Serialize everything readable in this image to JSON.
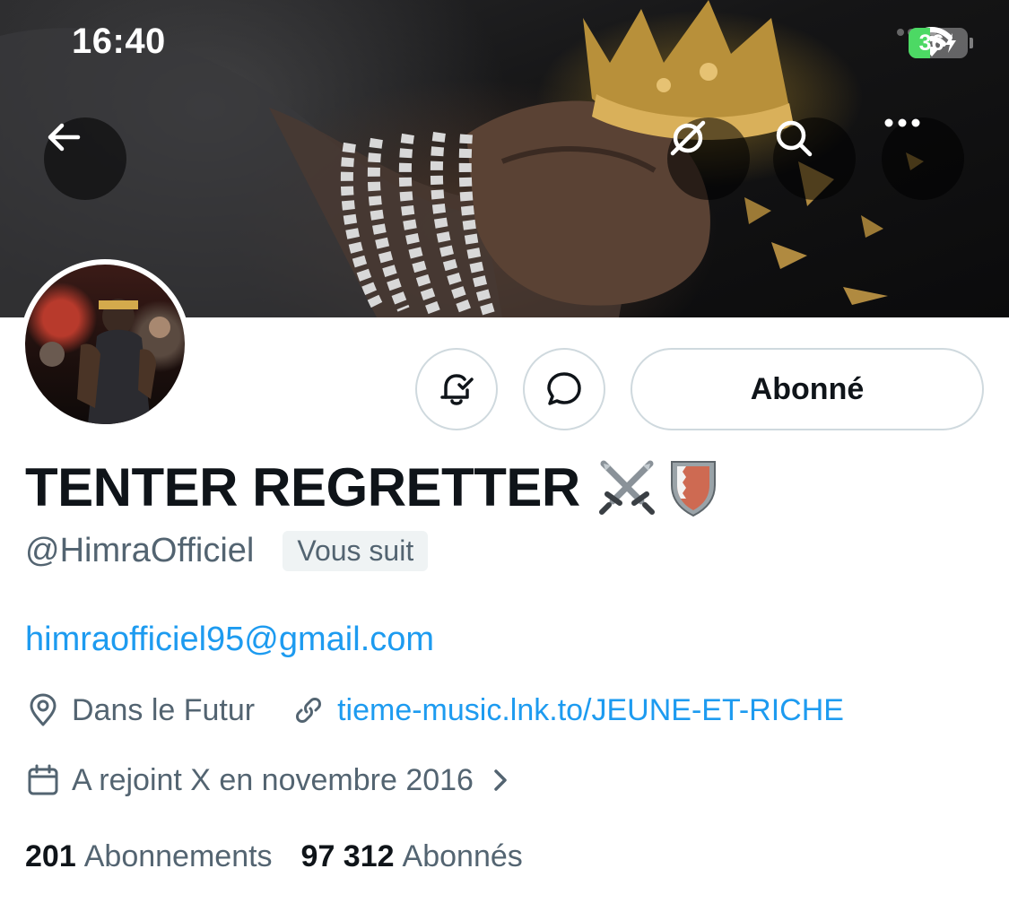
{
  "status_bar": {
    "time": "16:40",
    "battery_level": "36",
    "battery_fraction": 0.36,
    "wifi_icon": "wifi-icon",
    "charging": true
  },
  "banner_actions": {
    "back_icon": "arrow-left-icon",
    "grok_icon": "grok-icon",
    "search_icon": "search-icon",
    "more_icon": "more-horizontal-icon"
  },
  "actions": {
    "notifications_icon": "bell-check-icon",
    "message_icon": "message-bubble-icon",
    "follow_label": "Abonné"
  },
  "profile": {
    "display_name": "TENTER REGRETTER",
    "name_emojis": [
      "crossed-swords-emoji",
      "bahrain-shield-emoji"
    ],
    "handle": "@HimraOfficiel",
    "follows_you": "Vous suit",
    "bio": "himraofficiel95@gmail.com",
    "location": "Dans le Futur",
    "website": "tieme-music.lnk.to/JEUNE-ET-RICHE",
    "joined": "A rejoint X en novembre 2016"
  },
  "stats": {
    "following_count": "201",
    "following_label": "Abonnements",
    "followers_count": "97 312",
    "followers_label": "Abonnés"
  },
  "colors": {
    "text_primary": "#0f1419",
    "text_secondary": "#536471",
    "link": "#1d9bf0",
    "border": "#cfd9de",
    "battery_green": "#4cd964"
  }
}
